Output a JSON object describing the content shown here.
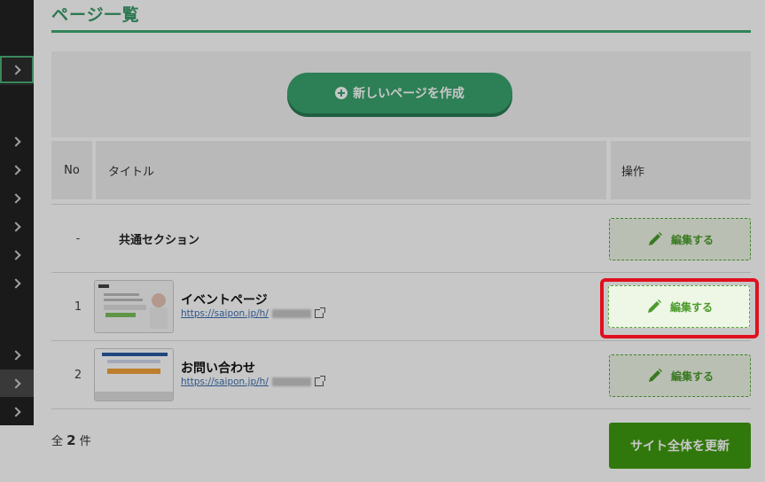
{
  "page": {
    "title": "ページ一覧"
  },
  "create_button": {
    "label": "新しいページを作成"
  },
  "table": {
    "headers": {
      "no": "No",
      "title": "タイトル",
      "operation": "操作"
    },
    "rows": [
      {
        "no": "-",
        "title": "共通セクション",
        "edit_label": "編集する"
      },
      {
        "no": "1",
        "name": "イベントページ",
        "url": "https://saipon.jp/h/",
        "edit_label": "編集する"
      },
      {
        "no": "2",
        "name": "お問い合わせ",
        "url": "https://saipon.jp/h/",
        "edit_label": "編集する"
      }
    ]
  },
  "footer": {
    "total_prefix": "全",
    "total_count": "2",
    "total_suffix": "件",
    "update_label": "サイト全体を更新"
  },
  "colors": {
    "accent": "#3aa36e",
    "edit": "#4b9b2b",
    "update": "#3f9a10",
    "highlight": "#e0101e"
  }
}
